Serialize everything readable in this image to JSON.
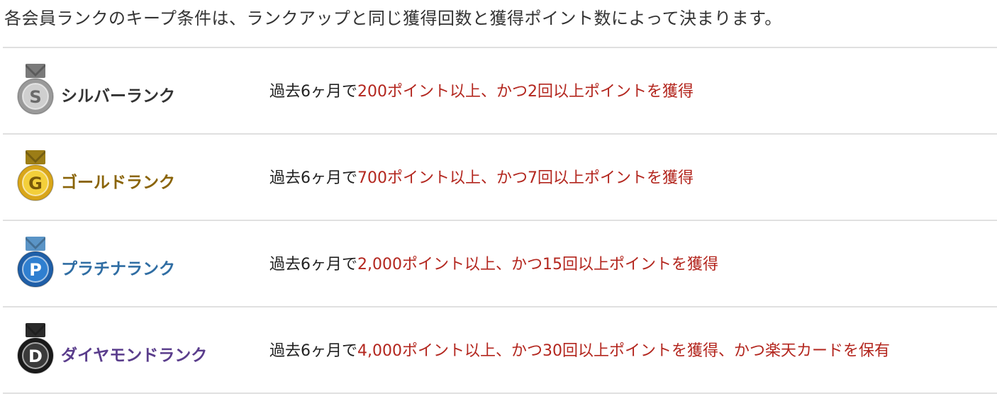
{
  "intro": "各会員ランクのキープ条件は、ランクアップと同じ獲得回数と獲得ポイント数によって決まります。",
  "ranks": [
    {
      "name": "シルバーランク",
      "letter": "S",
      "color": "#333333",
      "ribbon": "#7a7a7a",
      "medal_outer": "#9a9a9a",
      "medal_inner": "#cfcfcf",
      "letter_color": "#6a6a6a",
      "condition_prefix": "過去6ヶ月で",
      "condition_detail": "200ポイント以上、かつ2回以上ポイントを獲得"
    },
    {
      "name": "ゴールドランク",
      "letter": "G",
      "color": "#8a6408",
      "ribbon": "#9c7d16",
      "medal_outer": "#d9a619",
      "medal_inner": "#f3cf3a",
      "letter_color": "#7a5a08",
      "condition_prefix": "過去6ヶ月で",
      "condition_detail": "700ポイント以上、かつ7回以上ポイントを獲得"
    },
    {
      "name": "プラチナランク",
      "letter": "P",
      "color": "#2f6da3",
      "ribbon": "#5a94c6",
      "medal_outer": "#1f5fa8",
      "medal_inner": "#2f7fd0",
      "letter_color": "#ffffff",
      "condition_prefix": "過去6ヶ月で",
      "condition_detail": "2,000ポイント以上、かつ15回以上ポイントを獲得"
    },
    {
      "name": "ダイヤモンドランク",
      "letter": "D",
      "color": "#5a3d8c",
      "ribbon": "#2a2a2a",
      "medal_outer": "#1a1a1a",
      "medal_inner": "#3a3a3a",
      "letter_color": "#ffffff",
      "condition_prefix": "過去6ヶ月で",
      "condition_detail": "4,000ポイント以上、かつ30回以上ポイントを獲得、かつ楽天カードを保有"
    }
  ]
}
